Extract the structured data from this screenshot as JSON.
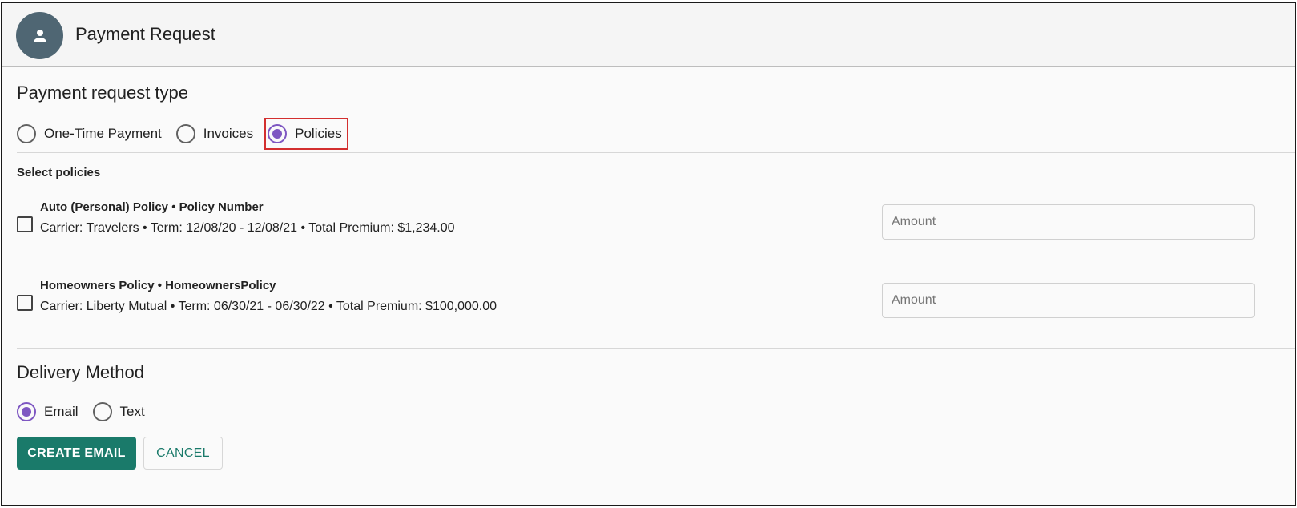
{
  "header": {
    "title": "Payment Request",
    "avatar_icon": "person-icon",
    "avatar_color": "#4f6673"
  },
  "request_type": {
    "title": "Payment request type",
    "options": [
      {
        "label": "One-Time Payment",
        "selected": false
      },
      {
        "label": "Invoices",
        "selected": false
      },
      {
        "label": "Policies",
        "selected": true
      }
    ]
  },
  "policies": {
    "title": "Select policies",
    "items": [
      {
        "title": "Auto (Personal) Policy • Policy Number",
        "details": "Carrier: Travelers • Term: 12/08/20 - 12/08/21 • Total Premium: $1,234.00",
        "amount_placeholder": "Amount",
        "checked": false
      },
      {
        "title": "Homeowners Policy • HomeownersPolicy",
        "details": "Carrier: Liberty Mutual • Term: 06/30/21 - 06/30/22 • Total Premium: $100,000.00",
        "amount_placeholder": "Amount",
        "checked": false
      }
    ]
  },
  "delivery": {
    "title": "Delivery Method",
    "options": [
      {
        "label": "Email",
        "selected": true
      },
      {
        "label": "Text",
        "selected": false
      }
    ]
  },
  "actions": {
    "create_label": "CREATE EMAIL",
    "cancel_label": "CANCEL"
  },
  "colors": {
    "accent": "#1a7a6a",
    "radio_selected": "#7e57c2",
    "highlight_box": "#d32f2f"
  }
}
